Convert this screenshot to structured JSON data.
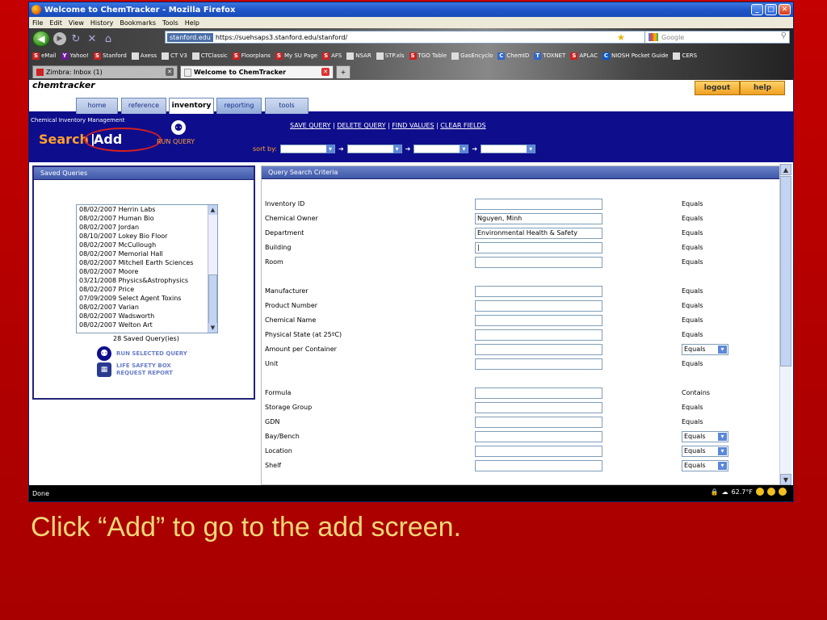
{
  "window": {
    "title": "Welcome to ChemTracker - Mozilla Firefox"
  },
  "menu": [
    "File",
    "Edit",
    "View",
    "History",
    "Bookmarks",
    "Tools",
    "Help"
  ],
  "url": {
    "site": "stanford.edu",
    "address": "https://suehsaps3.stanford.edu/stanford/"
  },
  "search": {
    "placeholder": "Google"
  },
  "bookmarks": [
    "eMail",
    "Yahoo!",
    "Stanford",
    "Axess",
    "CT V3",
    "CTClassic",
    "Floorplans",
    "My SU Page",
    "AFS",
    "NSAR",
    "STP.xls",
    "TGO Table",
    "GasEncyclo",
    "ChemID",
    "TOXNET",
    "APLAC",
    "NIOSH Pocket Guide",
    "CERS"
  ],
  "tabs": [
    {
      "label": "Zimbra: Inbox (1)"
    },
    {
      "label": "Welcome to ChemTracker"
    },
    {
      "label": "+"
    }
  ],
  "app": {
    "brand": "chemtracker",
    "logout": "logout",
    "help": "help",
    "nav": [
      "home",
      "reference",
      "inventory",
      "reporting",
      "tools"
    ],
    "section_title": "Chemical Inventory Management",
    "search_label": "Search",
    "separator": "|",
    "add_label": "Add",
    "run_query": "RUN QUERY",
    "query_links": [
      "SAVE QUERY",
      "DELETE QUERY",
      "FIND VALUES",
      "CLEAR FIELDS"
    ],
    "sort_by": "sort by:",
    "arrow": "➔"
  },
  "saved_queries": {
    "header": "Saved Queries",
    "items": [
      "08/02/2007 Herrin Labs",
      "08/02/2007 Human Bio",
      "08/02/2007 Jordan",
      "08/10/2007 Lokey Bio Floor",
      "08/02/2007 McCullough",
      "08/02/2007 Memorial Hall",
      "08/02/2007 Mitchell Earth Sciences",
      "08/02/2007 Moore",
      "03/21/2008 Physics&Astrophysics",
      "08/02/2007 Price",
      "07/09/2009 Select Agent Toxins",
      "08/02/2007 Varian",
      "08/02/2007 Wadsworth",
      "08/02/2007 Welton Art"
    ],
    "count": "28 Saved Query(ies)",
    "run_selected": "RUN SELECTED QUERY",
    "life_safety_1": "LIFE SAFETY BOX",
    "life_safety_2": "REQUEST REPORT"
  },
  "criteria": {
    "header": "Query Search Criteria",
    "fields": [
      {
        "label": "Inventory ID",
        "value": "",
        "op": "Equals",
        "op_select": false
      },
      {
        "label": "Chemical Owner",
        "value": "Nguyen, Minh",
        "op": "Equals",
        "op_select": false
      },
      {
        "label": "Department",
        "value": "Environmental Health & Safety",
        "op": "Equals",
        "op_select": false
      },
      {
        "label": "Building",
        "value": "|",
        "op": "Equals",
        "op_select": false
      },
      {
        "label": "Room",
        "value": "",
        "op": "Equals",
        "op_select": false
      },
      {
        "label": "Manufacturer",
        "value": "",
        "op": "Equals",
        "op_select": false
      },
      {
        "label": "Product Number",
        "value": "",
        "op": "Equals",
        "op_select": false
      },
      {
        "label": "Chemical Name",
        "value": "",
        "op": "Equals",
        "op_select": false
      },
      {
        "label": "Physical State (at 25ºC)",
        "value": "",
        "op": "Equals",
        "op_select": false
      },
      {
        "label": "Amount per Container",
        "value": "",
        "op": "Equals",
        "op_select": true
      },
      {
        "label": "Unit",
        "value": "",
        "op": "Equals",
        "op_select": false
      },
      {
        "label": "Formula",
        "value": "",
        "op": "Contains",
        "op_select": false
      },
      {
        "label": "Storage Group",
        "value": "",
        "op": "Equals",
        "op_select": false
      },
      {
        "label": "GDN",
        "value": "",
        "op": "Equals",
        "op_select": false
      },
      {
        "label": "Bay/Bench",
        "value": "",
        "op": "Equals",
        "op_select": true
      },
      {
        "label": "Location",
        "value": "",
        "op": "Equals",
        "op_select": true
      },
      {
        "label": "Shelf",
        "value": "",
        "op": "Equals",
        "op_select": true
      }
    ]
  },
  "status": {
    "text": "Done",
    "temp": "62.7°F"
  },
  "caption": "Click “Add” to go to the add screen."
}
